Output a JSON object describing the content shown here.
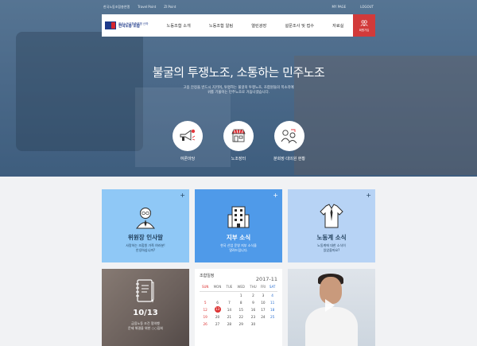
{
  "topbar": {
    "left_links": [
      "한국노동조합총연맹",
      "Travel Point",
      "ZI Point"
    ],
    "right_links": [
      "MY PAGE",
      "LOGOUT"
    ]
  },
  "logo": {
    "line1": "한국노동조합총연맹 산하",
    "line2": "한국노총 조합"
  },
  "nav": {
    "items": [
      "노동조합 소개",
      "노동조합 알림",
      "열린광장",
      "설문조사 및 접수",
      "자료실"
    ],
    "member_label": "회원가입"
  },
  "hero": {
    "headline": "불굴의 투쟁노조, 소통하는 민주노조",
    "sub_line1": "고용 안정을 반드시 지키며, 투명하는 불굴의 투쟁노조, 조합원들의 목소리에",
    "sub_line2": "귀를 기울이는 민주노조로 거듭나겠습니다."
  },
  "quick_links": [
    {
      "label": "여론마당",
      "icon": "megaphone-icon"
    },
    {
      "label": "노조장터",
      "icon": "store-icon"
    },
    {
      "label": "분회장·대의원 현황",
      "icon": "people-icon"
    }
  ],
  "cards": [
    {
      "title": "위원장 인사말",
      "desc1": "사랑하는 조합원 가족 여러분!",
      "desc2": "안녕하십니까?",
      "icon": "leader-icon"
    },
    {
      "title": "지부 소식",
      "desc1": "한국 산업 운영 지부 소식을",
      "desc2": "알려드립니다.",
      "icon": "building-icon"
    },
    {
      "title": "노동계 소식",
      "desc1": "노동계에 대한 소식이",
      "desc2": "있었을까요?",
      "icon": "shirt-icon"
    }
  ],
  "event": {
    "date": "10/13",
    "desc1": "금융노동 조건 쟁의행",
    "desc2": "문제 해결을 위한 ○○집회"
  },
  "calendar": {
    "title": "조합일정",
    "year_month": "2017-11",
    "weekdays": [
      "SUN",
      "MON",
      "TUE",
      "WED",
      "THU",
      "FRI",
      "SAT"
    ],
    "rows": [
      [
        "",
        "",
        "",
        "1",
        "2",
        "3",
        "4"
      ],
      [
        "5",
        "6",
        "7",
        "8",
        "9",
        "10",
        "11"
      ],
      [
        "12",
        "13",
        "14",
        "15",
        "16",
        "17",
        "18"
      ],
      [
        "19",
        "20",
        "21",
        "22",
        "23",
        "24",
        "25"
      ],
      [
        "26",
        "27",
        "28",
        "29",
        "30",
        "",
        ""
      ]
    ],
    "today": "13"
  }
}
